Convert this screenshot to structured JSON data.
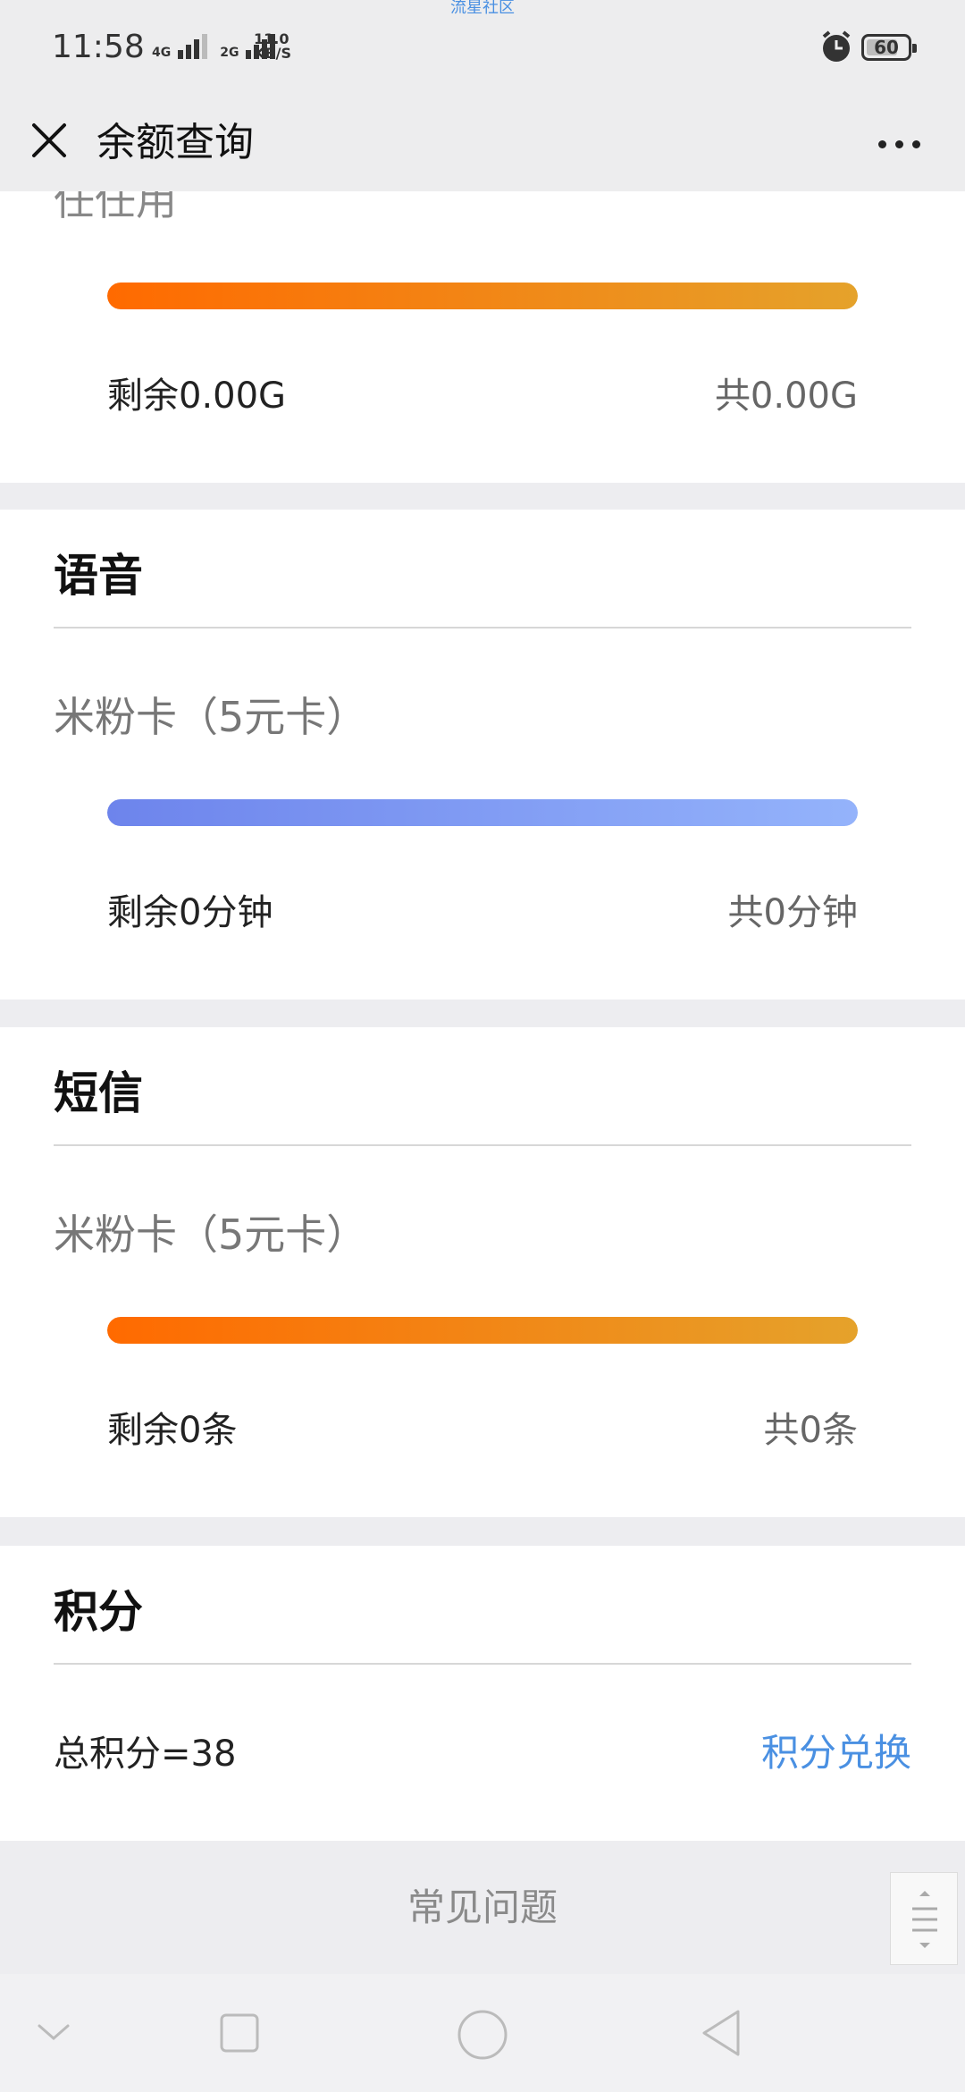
{
  "status": {
    "watermark": "流星社区",
    "time": "11:58",
    "net1": "4G",
    "net2": "2G",
    "speed_value": "11.0",
    "speed_unit": "KB/S",
    "battery": "60"
  },
  "header": {
    "title": "余额查询"
  },
  "data_section": {
    "partial_plan_name": "任任用",
    "progress": 1.0,
    "remaining": "剩余0.00G",
    "total": "共0.00G",
    "bar_color": "orange"
  },
  "voice_section": {
    "title": "语音",
    "plan_name": "米粉卡（5元卡）",
    "progress": 1.0,
    "remaining": "剩余0分钟",
    "total": "共0分钟",
    "bar_color": "blue"
  },
  "sms_section": {
    "title": "短信",
    "plan_name": "米粉卡（5元卡）",
    "progress": 1.0,
    "remaining": "剩余0条",
    "total": "共0条",
    "bar_color": "orange"
  },
  "points_section": {
    "title": "积分",
    "total_points": "总积分=38",
    "exchange_link": "积分兑换"
  },
  "footer": {
    "faq": "常见问题"
  },
  "colors": {
    "accent_blue": "#4a90e2",
    "orange_start": "#ff6a00",
    "orange_end": "#e5a22b",
    "blue_start": "#6d84ec",
    "blue_end": "#94b3fb"
  },
  "nav_icons": [
    "chevron-down-icon",
    "recent-apps-icon",
    "home-icon",
    "back-icon"
  ]
}
